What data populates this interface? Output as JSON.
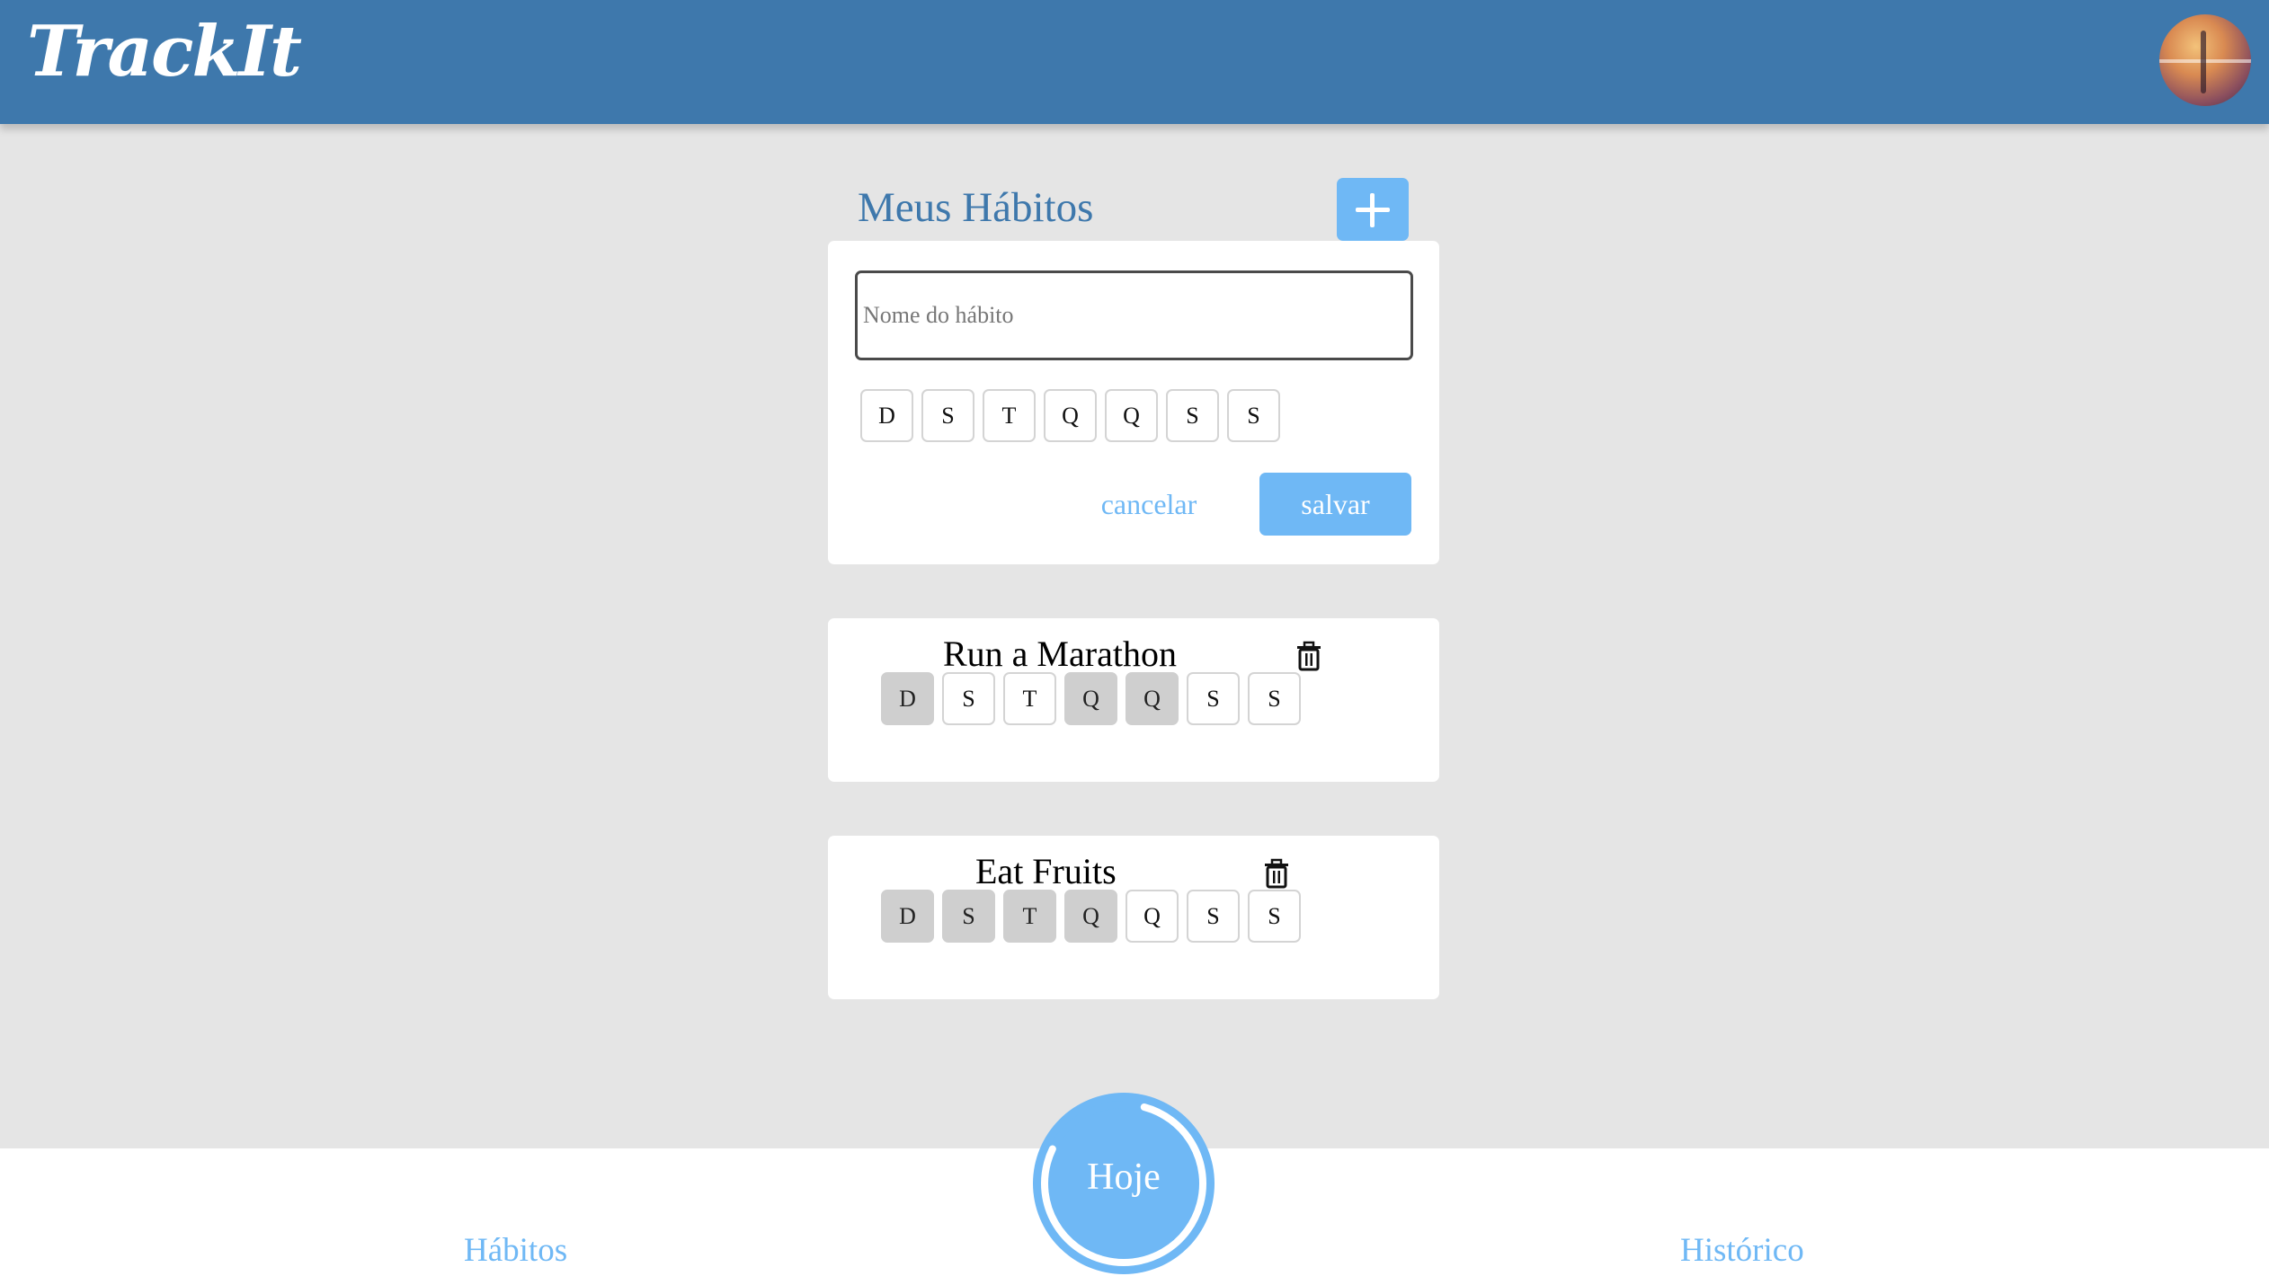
{
  "header": {
    "logo": "TrackIt",
    "avatar": "user-avatar"
  },
  "main": {
    "title": "Meus Hábitos",
    "add_button_icon": "plus-icon"
  },
  "new_habit_form": {
    "name_placeholder": "Nome do hábito",
    "name_value": "",
    "days": [
      {
        "label": "D",
        "selected": false
      },
      {
        "label": "S",
        "selected": false
      },
      {
        "label": "T",
        "selected": false
      },
      {
        "label": "Q",
        "selected": false
      },
      {
        "label": "Q",
        "selected": false
      },
      {
        "label": "S",
        "selected": false
      },
      {
        "label": "S",
        "selected": false
      }
    ],
    "cancel_label": "cancelar",
    "save_label": "salvar"
  },
  "habits": [
    {
      "name": "Run a Marathon",
      "delete_icon": "trash-icon",
      "days": [
        {
          "label": "D",
          "selected": true
        },
        {
          "label": "S",
          "selected": false
        },
        {
          "label": "T",
          "selected": false
        },
        {
          "label": "Q",
          "selected": true
        },
        {
          "label": "Q",
          "selected": true
        },
        {
          "label": "S",
          "selected": false
        },
        {
          "label": "S",
          "selected": false
        }
      ]
    },
    {
      "name": "Eat Fruits",
      "delete_icon": "trash-icon",
      "days": [
        {
          "label": "D",
          "selected": true
        },
        {
          "label": "S",
          "selected": true
        },
        {
          "label": "T",
          "selected": true
        },
        {
          "label": "Q",
          "selected": true
        },
        {
          "label": "Q",
          "selected": false
        },
        {
          "label": "S",
          "selected": false
        },
        {
          "label": "S",
          "selected": false
        }
      ]
    }
  ],
  "footer": {
    "habits_label": "Hábitos",
    "today_label": "Hoje",
    "today_progress": 0.78,
    "history_label": "Histórico"
  },
  "colors": {
    "header": "#3e78ac",
    "accent": "#6fb8f5",
    "background": "#e5e5e5",
    "selected_day": "#cfcfcf"
  }
}
